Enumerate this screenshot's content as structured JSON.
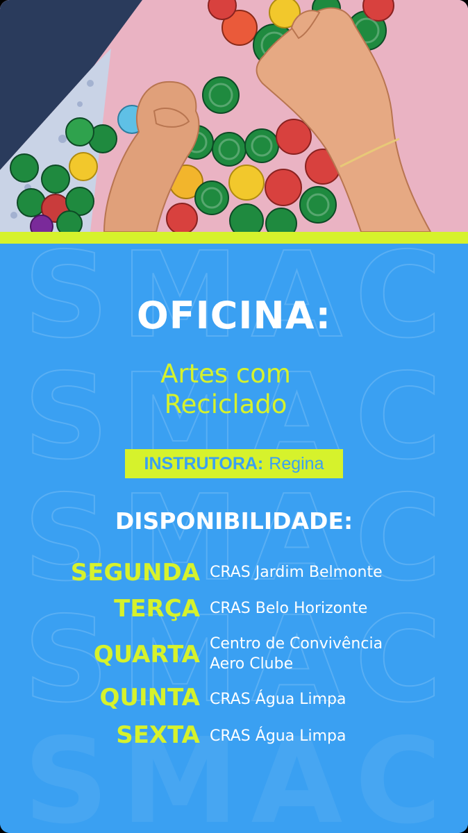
{
  "poster": {
    "title": "OFICINA:",
    "workshop_line1": "Artes com",
    "workshop_line2": "Reciclado",
    "instructor_label": "INSTRUTORA:",
    "instructor_name": "Regina",
    "availability_heading": "DISPONIBILIDADE:",
    "watermark": "SMAC",
    "schedule": [
      {
        "day": "SEGUNDA",
        "place": "CRAS Jardim Belmonte"
      },
      {
        "day": "TERÇA",
        "place": "CRAS Belo Horizonte"
      },
      {
        "day": "QUARTA",
        "place_line1": "Centro de Convivência",
        "place_line2": "Aero Clube"
      },
      {
        "day": "QUINTA",
        "place": "CRAS Água Limpa"
      },
      {
        "day": "SEXTA",
        "place": "CRAS Água Limpa"
      }
    ]
  },
  "colors": {
    "background_blue": "#3aa0f2",
    "accent_lime": "#d6f22c",
    "text_white": "#ffffff"
  },
  "photo": {
    "subject": "child-hands-sorting-bottle-caps"
  }
}
